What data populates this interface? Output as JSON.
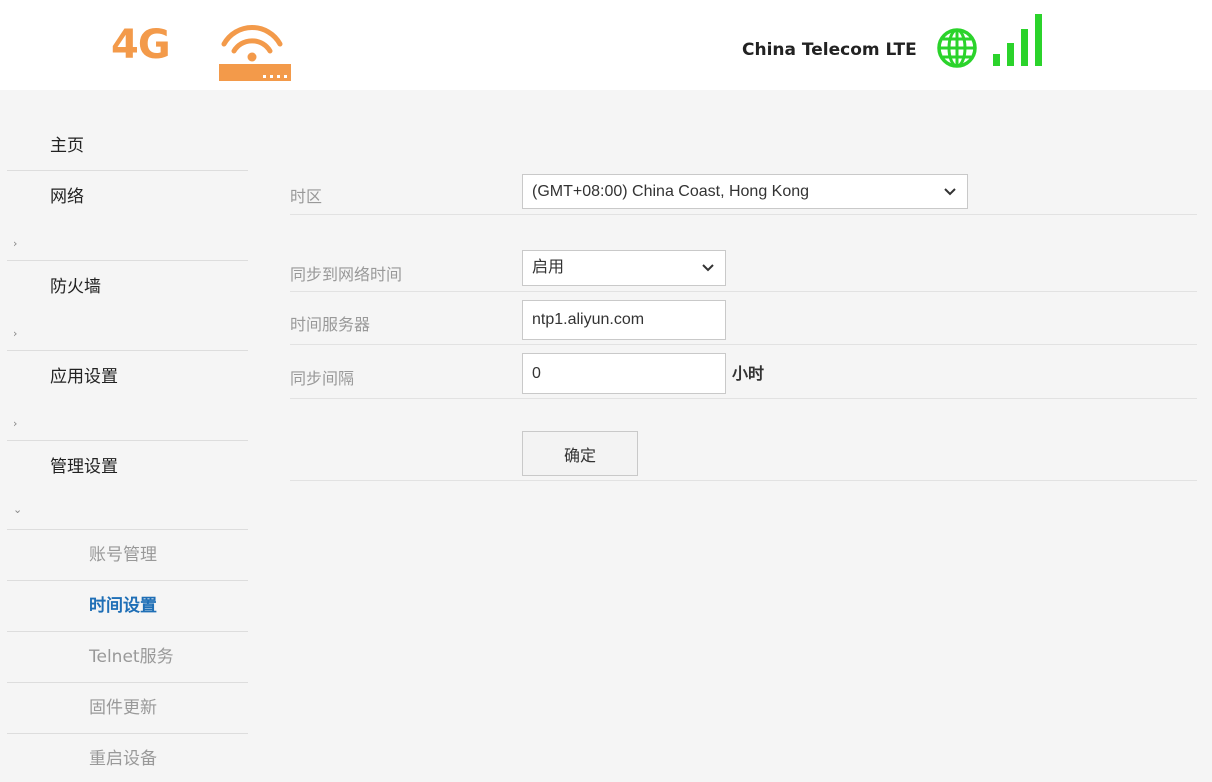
{
  "header": {
    "logo_text": "4G",
    "carrier": "China Telecom LTE",
    "icons": {
      "router": "router-wifi-icon",
      "globe": "globe-icon",
      "signal": "signal-strength-icon"
    },
    "colors": {
      "accent": "#f39a4a",
      "status": "#2bd32b"
    }
  },
  "sidebar": {
    "items": [
      {
        "label": "主页"
      },
      {
        "label": "网络",
        "chevron": "›"
      },
      {
        "label": "防火墙",
        "chevron": "›"
      },
      {
        "label": "应用设置",
        "chevron": "›"
      },
      {
        "label": "管理设置",
        "chevron": "⌄"
      }
    ],
    "subitems": [
      {
        "label": "账号管理"
      },
      {
        "label": "时间设置",
        "active": true
      },
      {
        "label": "Telnet服务"
      },
      {
        "label": "固件更新"
      },
      {
        "label": "重启设备"
      }
    ],
    "active_color": "#1f6fb6"
  },
  "form": {
    "timezone": {
      "label": "时区",
      "value": "(GMT+08:00) China Coast, Hong Kong"
    },
    "sync": {
      "label": "同步到网络时间",
      "value": "启用"
    },
    "server": {
      "label": "时间服务器",
      "value": "ntp1.aliyun.com"
    },
    "interval": {
      "label": "同步间隔",
      "value": "0",
      "unit": "小时"
    },
    "submit_label": "确定"
  }
}
